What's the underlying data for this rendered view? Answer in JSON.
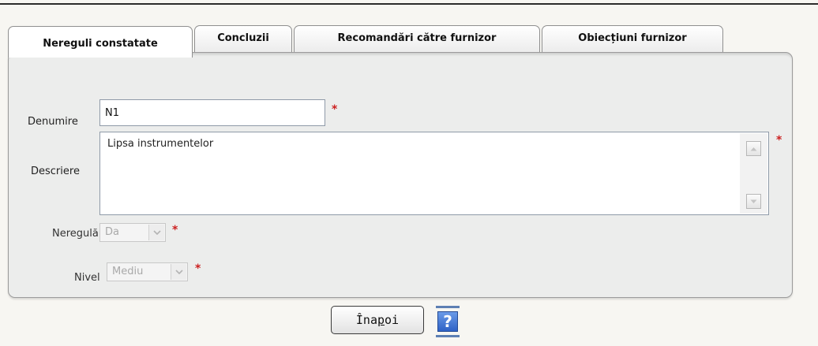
{
  "tabs": [
    {
      "label": "Nereguli constatate",
      "active": true
    },
    {
      "label": "Concluzii",
      "active": false
    },
    {
      "label": "Recomandări către furnizor",
      "active": false
    },
    {
      "label": "Obiecțiuni furnizor",
      "active": false
    }
  ],
  "form": {
    "denumire_label": "Denumire",
    "denumire_value": "N1",
    "descriere_label": "Descriere",
    "descriere_value": "Lipsa instrumentelor",
    "neregula_label": "Neregulă",
    "neregula_value": "Da",
    "nivel_label": "Nivel",
    "nivel_value": "Mediu",
    "required_mark": "*"
  },
  "actions": {
    "back_label_pre": "Îna",
    "back_label_mnemonic": "p",
    "back_label_post": "oi",
    "help_icon": "help-question-icon",
    "help_glyph": "?"
  },
  "colors": {
    "required": "#cc2020",
    "panel": "#ecedec",
    "help": "#2f62c6"
  }
}
